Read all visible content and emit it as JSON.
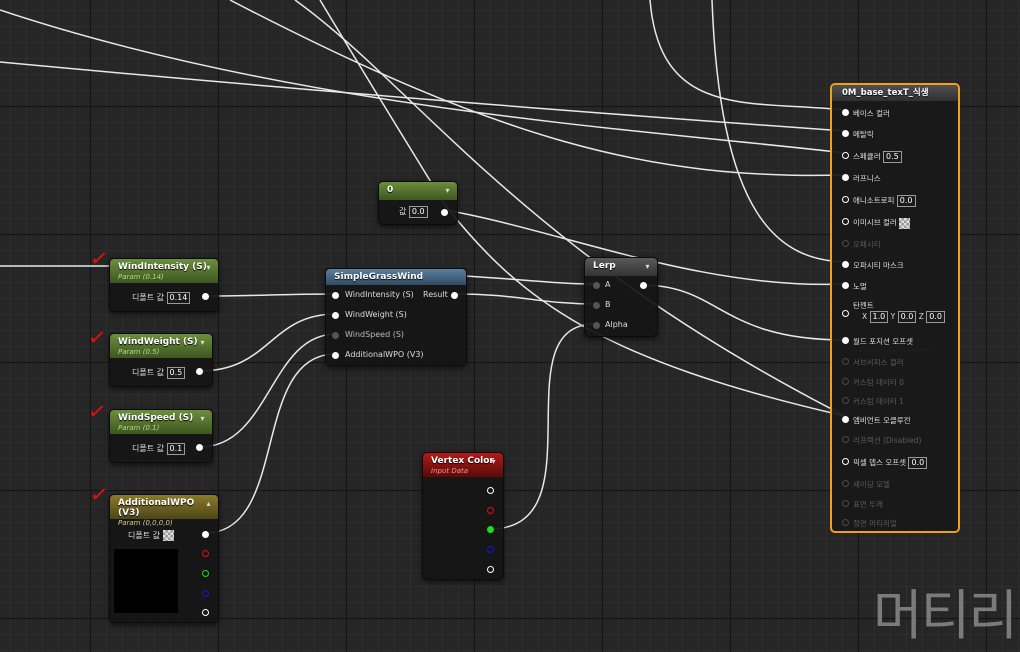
{
  "nodes": {
    "wind_intensity": {
      "title": "WindIntensity (S)",
      "subtitle": "Param (0.14)",
      "label": "디폴트 값",
      "value": "0.14"
    },
    "wind_weight": {
      "title": "WindWeight (S)",
      "subtitle": "Param (0.5)",
      "label": "디폴트 값",
      "value": "0.5"
    },
    "wind_speed": {
      "title": "WindSpeed (S)",
      "subtitle": "Param (0.1)",
      "label": "디폴트 값",
      "value": "0.1"
    },
    "additional_wpo": {
      "title": "AdditionalWPO (V3)",
      "subtitle": "Param (0,0,0,0)",
      "label": "디폴트 값"
    },
    "constant": {
      "title": "0",
      "label": "값",
      "value": "0.0"
    },
    "simple_grass_wind": {
      "title": "SimpleGrassWind",
      "inputs": [
        "WindIntensity (S)",
        "WindWeight (S)",
        "WindSpeed (S)",
        "AdditionalWPO (V3)"
      ],
      "output": "Result"
    },
    "lerp": {
      "title": "Lerp",
      "inputs": [
        "A",
        "B",
        "Alpha"
      ]
    },
    "vertex_color": {
      "title": "Vertex Color",
      "subtitle": "Input Data"
    }
  },
  "material": {
    "title": "0M_base_texT_식생",
    "rows": [
      {
        "label": "베이스 컬러",
        "active": true
      },
      {
        "label": "메탈릭",
        "active": true
      },
      {
        "label": "스페큘러",
        "active": true,
        "value": "0.5"
      },
      {
        "label": "러프니스",
        "active": true
      },
      {
        "label": "애니소트로피",
        "active": true,
        "value": "0.0"
      },
      {
        "label": "이미시브 컬러",
        "active": true,
        "checker": true
      },
      {
        "label": "오패시티",
        "active": false
      },
      {
        "label": "오파시티 마스크",
        "active": true
      },
      {
        "label": "노멀",
        "active": true
      },
      {
        "label": "탄젠트",
        "active": true
      },
      {
        "label": "월드 포지션 오프셋",
        "active": true
      },
      {
        "label": "서브서피스 컬러",
        "active": false
      },
      {
        "label": "커스텀 데이터 0",
        "active": false
      },
      {
        "label": "커스텀 데이터 1",
        "active": false
      },
      {
        "label": "앰비언트 오클루전",
        "active": true
      },
      {
        "label": "리프랙션 (Disabled)",
        "active": false
      },
      {
        "label": "픽셀 뎁스 오프셋",
        "active": true,
        "value": "0.0"
      },
      {
        "label": "셰이딩 모델",
        "active": false
      },
      {
        "label": "표면 두께",
        "active": false
      },
      {
        "label": "정면 머티리얼",
        "active": false
      }
    ],
    "tangent": {
      "x": "1.0",
      "y": "0.0",
      "z": "0.0",
      "x_label": "X",
      "y_label": "Y",
      "z_label": "Z"
    }
  },
  "watermark": "머티리",
  "colors": {
    "accent": "#f0a020",
    "annotation": "#e01010"
  }
}
